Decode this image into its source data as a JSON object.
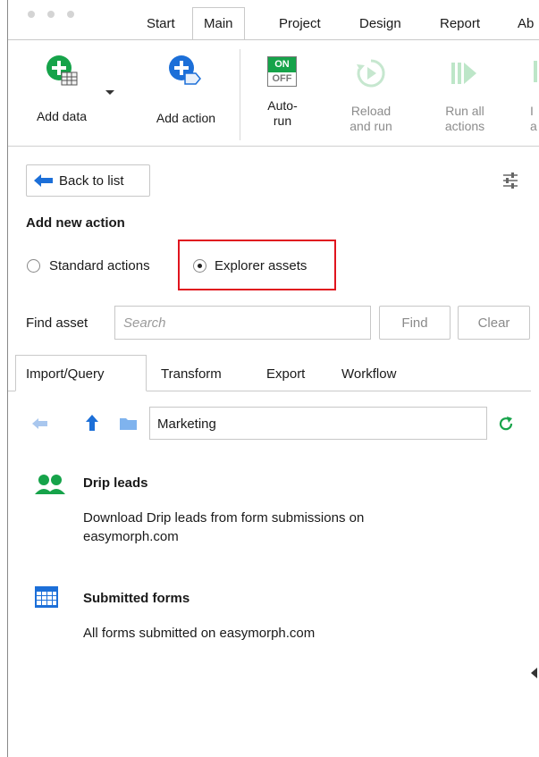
{
  "tabs": [
    "Start",
    "Main",
    "Project",
    "Design",
    "Report",
    "Ab"
  ],
  "ribbon": {
    "add_data": "Add data",
    "add_action": "Add action",
    "toggle_on": "ON",
    "toggle_off": "OFF",
    "auto_run_1": "Auto-",
    "auto_run_2": "run",
    "reload_1": "Reload",
    "reload_2": "and run",
    "run_all_1": "Run all",
    "run_all_2": "actions",
    "partial_1": "I",
    "partial_2": "a"
  },
  "panel": {
    "back_button": "Back to list",
    "heading": "Add new action",
    "radio_standard": "Standard actions",
    "radio_explorer": "Explorer assets",
    "find_label": "Find asset",
    "search_placeholder": "Search",
    "find_button": "Find",
    "clear_button": "Clear"
  },
  "subtabs": [
    "Import/Query",
    "Transform",
    "Export",
    "Workflow"
  ],
  "folder": {
    "name": "Marketing"
  },
  "assets": [
    {
      "title": "Drip leads",
      "desc_line1": "Download Drip leads from form submissions on",
      "desc_line2": "easymorph.com",
      "icon": "users-icon"
    },
    {
      "title": "Submitted forms",
      "desc_line1": "All forms submitted on easymorph.com",
      "icon": "table-icon"
    }
  ],
  "colors": {
    "accent_blue": "#1c6fd8",
    "green": "#16a34a",
    "highlight_red": "#e0141e"
  }
}
